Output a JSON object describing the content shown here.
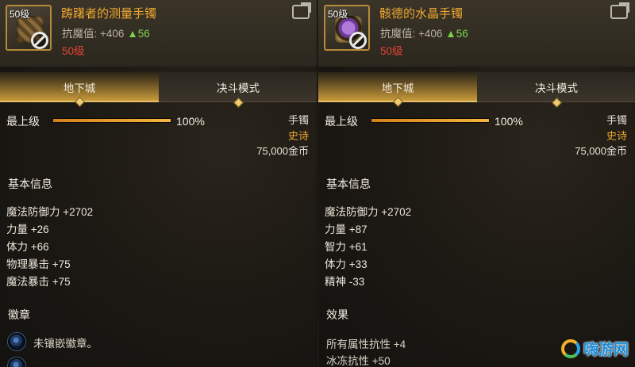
{
  "left": {
    "level_badge": "50级",
    "item_name": "踌躇者的测量手镯",
    "magic_resist_label": "抗魔值: +406",
    "magic_resist_delta": "▲56",
    "required_level": "50级",
    "tabs": [
      {
        "label": "地下城"
      },
      {
        "label": "决斗模式"
      }
    ],
    "grade_label": "最上级",
    "grade_percent_value": 100,
    "grade_percent": "100%",
    "slot": "手镯",
    "rarity": "史诗",
    "price": "75,000金币",
    "basic_info_title": "基本信息",
    "stats": [
      "魔法防御力 +2702",
      "力量 +26",
      "体力 +66",
      "物理暴击 +75",
      "魔法暴击 +75"
    ],
    "emblem_title": "徽章",
    "emblem_slots": [
      "未镶嵌徽章。",
      ""
    ]
  },
  "right": {
    "level_badge": "50级",
    "item_name": "骸德的水晶手镯",
    "magic_resist_label": "抗魔值: +406",
    "magic_resist_delta": "▲56",
    "required_level": "50级",
    "tabs": [
      {
        "label": "地下城"
      },
      {
        "label": "决斗模式"
      }
    ],
    "grade_label": "最上级",
    "grade_percent_value": 100,
    "grade_percent": "100%",
    "slot": "手镯",
    "rarity": "史诗",
    "price": "75,000金币",
    "basic_info_title": "基本信息",
    "stats": [
      "魔法防御力 +2702",
      "力量 +87",
      "智力 +61",
      "体力 +33",
      "精神 -33"
    ],
    "effect_title": "效果",
    "effects": [
      "所有属性抗性 +4",
      "冰冻抗性 +50"
    ]
  },
  "watermark": {
    "text": "嗨游网"
  },
  "colors": {
    "item_name": "#f0a830",
    "required_level": "#e04434",
    "delta_up": "#7cd34a",
    "rarity_epic": "#f0a830"
  },
  "icons": [
    "share-icon",
    "disabled-icon",
    "emblem-slot-icon",
    "site-logo-icon"
  ]
}
